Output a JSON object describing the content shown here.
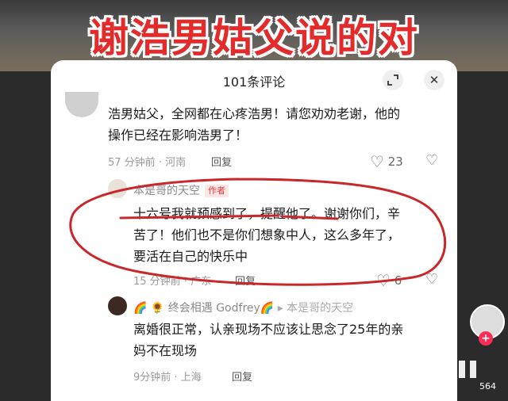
{
  "banner": {
    "title": "谢浩男姑父说的对"
  },
  "sheet": {
    "comment_count": "101条评论"
  },
  "comments": [
    {
      "text_l1": "浩男姑父，全网都在心疼浩男！请您劝劝老谢，他的",
      "text_l2": "操作已经在影响浩男了！",
      "time_loc": "57 分钟前 · 河南",
      "reply": "回复",
      "likes": "23"
    },
    {
      "name": "本是哥的天空",
      "tag": "作者",
      "text_l1": "十六号我就预感到了，提醒他了。谢谢你们，辛",
      "text_l2": "苦了！他们也不是你们想象中人，这么多年了，",
      "text_l3": "要活在自己的快乐中",
      "time_loc": "15 分钟前 · 广东",
      "reply": "回复",
      "likes": "6"
    },
    {
      "name": "🌈 🌻 终会相遇 Godfrey🌈",
      "reply_to": "▸ 本是哥的天空",
      "text_l1": "离婚很正常，认亲现场不应该让思念了25年的亲",
      "text_l2": "妈不在现场",
      "time_loc": "9分钟前 · 上海",
      "reply": "回复"
    }
  ],
  "rail": {
    "count": "564"
  },
  "colors": {
    "annotation": "#c8282b",
    "author_tag": "#ef3b3b",
    "follow": "#fe2c55"
  }
}
